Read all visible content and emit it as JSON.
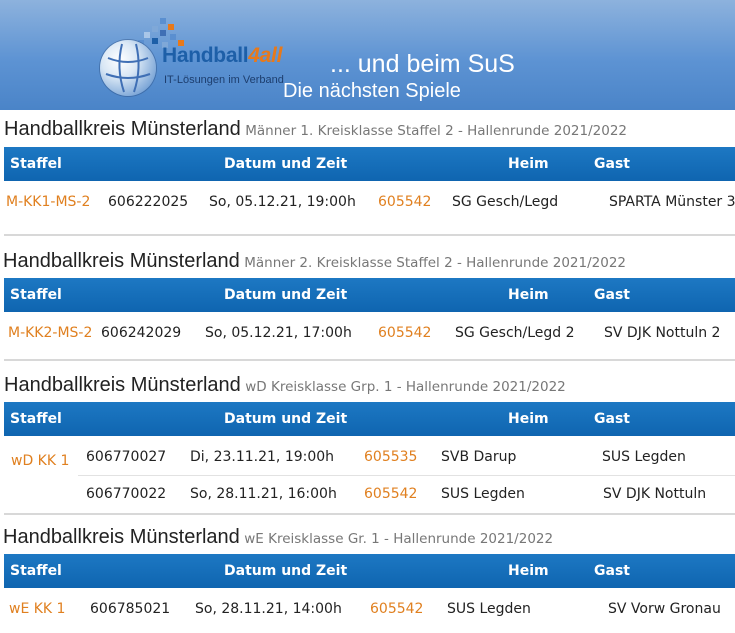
{
  "banner": {
    "logo_main": "Handball",
    "logo_four": "4all",
    "logo_sub": "IT-Lösungen im Verband",
    "title": "... und beim SuS",
    "subtitle": "Die nächsten Spiele"
  },
  "columns": {
    "staffel": "Staffel",
    "datum": "Datum und Zeit",
    "heim": "Heim",
    "gast": "Gast"
  },
  "sections": [
    {
      "title": "Handballkreis Münsterland",
      "subtitle": "Männer 1. Kreisklasse Staffel 2 - Hallenrunde 2021/2022",
      "rows": [
        {
          "staffel": "M-KK1-MS-2",
          "nr": "606222025",
          "datum": "So, 05.12.21, 19:00h",
          "halle": "605542",
          "heim": "SG Gesch/Legd",
          "gast": "SPARTA Münster 3"
        }
      ]
    },
    {
      "title": "Handballkreis Münsterland",
      "subtitle": "Männer 2. Kreisklasse Staffel 2 - Hallenrunde 2021/2022",
      "rows": [
        {
          "staffel": "M-KK2-MS-2",
          "nr": "606242029",
          "datum": "So, 05.12.21, 17:00h",
          "halle": "605542",
          "heim": "SG Gesch/Legd 2",
          "gast": "SV DJK Nottuln 2"
        }
      ]
    },
    {
      "title": "Handballkreis Münsterland",
      "subtitle": "wD Kreisklasse Grp. 1 - Hallenrunde 2021/2022",
      "rows": [
        {
          "staffel": "wD KK 1",
          "nr": "606770027",
          "datum": "Di, 23.11.21, 19:00h",
          "halle": "605535",
          "heim": "SVB Darup",
          "gast": "SUS Legden"
        },
        {
          "staffel": "",
          "nr": "606770022",
          "datum": "So, 28.11.21, 16:00h",
          "halle": "605542",
          "heim": "SUS Legden",
          "gast": "SV DJK Nottuln"
        }
      ]
    },
    {
      "title": "Handballkreis Münsterland",
      "subtitle": "wE Kreisklasse Gr. 1 - Hallenrunde 2021/2022",
      "rows": [
        {
          "staffel": "wE KK 1",
          "nr": "606785021",
          "datum": "So, 28.11.21, 14:00h",
          "halle": "605542",
          "heim": "SUS Legden",
          "gast": "SV Vorw Gronau"
        }
      ]
    }
  ]
}
